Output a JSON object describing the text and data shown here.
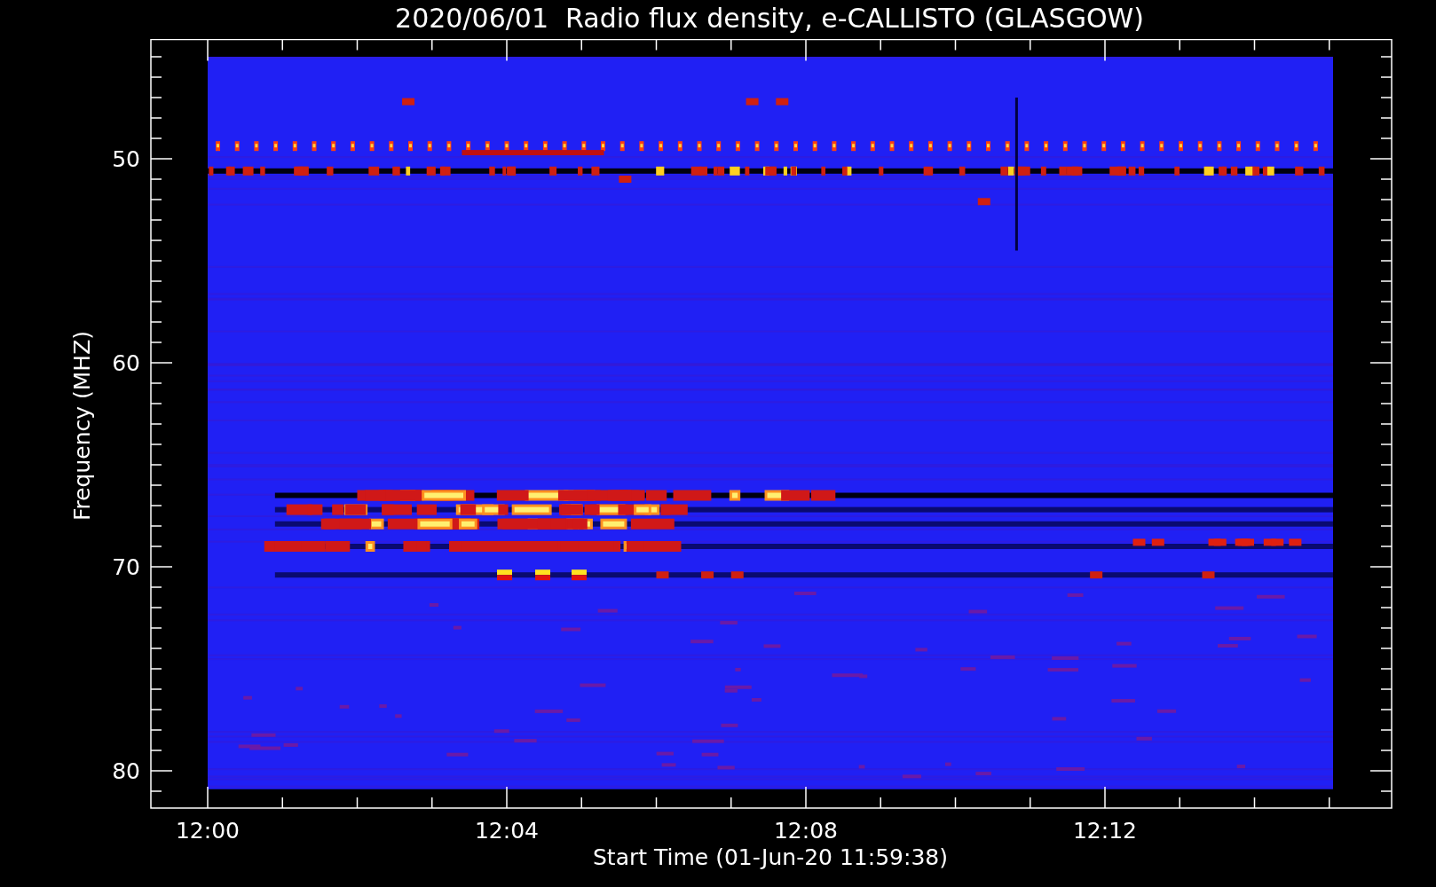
{
  "plot": {
    "title": "2020/06/01  Radio flux density, e-CALLISTO (GLASGOW)",
    "ylabel": "Frequency (MHZ)",
    "xlabel": "Start Time (01-Jun-20 11:59:38)",
    "yticks": [
      "50",
      "60",
      "70",
      "80"
    ],
    "xticks": [
      "12:00",
      "12:04",
      "12:08",
      "12:12"
    ]
  }
}
